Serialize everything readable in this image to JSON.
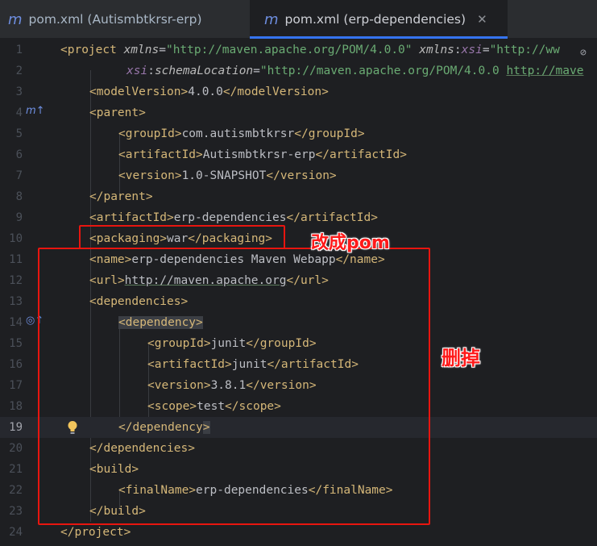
{
  "tabs": [
    {
      "label": "pom.xml (Autismbtkrsr-erp)",
      "icon": "maven-icon"
    },
    {
      "label": "pom.xml (erp-dependencies)",
      "icon": "maven-icon",
      "active": true
    }
  ],
  "lines": {
    "n1": "1",
    "n2": "2",
    "n3": "3",
    "n4": "4",
    "n5": "5",
    "n6": "6",
    "n7": "7",
    "n8": "8",
    "n9": "9",
    "n10": "10",
    "n11": "11",
    "n12": "12",
    "n13": "13",
    "n14": "14",
    "n15": "15",
    "n16": "16",
    "n17": "17",
    "n18": "18",
    "n19": "19",
    "n20": "20",
    "n21": "21",
    "n22": "22",
    "n23": "23",
    "n24": "24"
  },
  "code": {
    "project": "project",
    "xmlns_attr": "xmlns",
    "xmlns_val": "\"http://maven.apache.org/POM/4.0.0\"",
    "xmlns_xsi_prefix": "xmlns",
    "xmlns_xsi_name": "xsi",
    "xmlns_xsi_val": "\"http://ww",
    "xsi_prefix": "xsi",
    "schema_attr": "schemaLocation",
    "schema_val_a": "\"http://maven.apache.org/POM/4.0.0 ",
    "schema_val_b": "http://mave",
    "modelVersion": "modelVersion",
    "modelVersion_val": "4.0.0",
    "parent": "parent",
    "groupId": "groupId",
    "groupId_val": "com.autismbtkrsr",
    "artifactId": "artifactId",
    "parent_artifactId_val": "Autismbtkrsr-erp",
    "version": "version",
    "parent_version_val": "1.0-SNAPSHOT",
    "artifactId_val": "erp-dependencies",
    "packaging": "packaging",
    "packaging_val": "war",
    "name": "name",
    "name_val": "erp-dependencies Maven Webapp",
    "url": "url",
    "url_val": "http://maven.apache.org",
    "dependencies": "dependencies",
    "dependency": "dependency",
    "dep_groupId_val": "junit",
    "dep_artifactId_val": "junit",
    "dep_version_val": "3.8.1",
    "scope": "scope",
    "scope_val": "test",
    "build": "build",
    "finalName": "finalName",
    "finalName_val": "erp-dependencies"
  },
  "annotations": {
    "change_label": "改成pom",
    "delete_label": "删掉"
  },
  "colors": {
    "annotation_red": "#e8150f",
    "tag": "#d5b778",
    "string": "#6aab73"
  }
}
